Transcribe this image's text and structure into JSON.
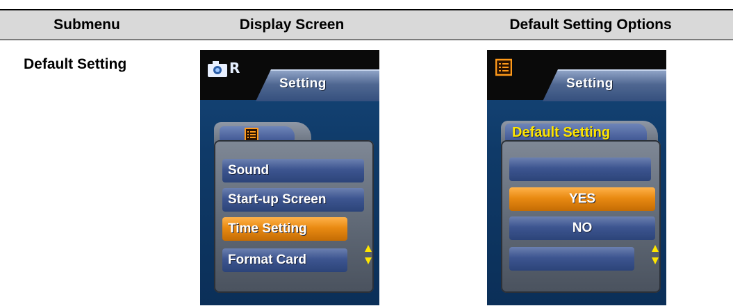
{
  "table": {
    "headers": [
      "Submenu",
      "Display Screen",
      "Default Setting Options"
    ],
    "row_label": "Default Setting"
  },
  "screen_left": {
    "mode_letter": "R",
    "tab_title": "Setting",
    "items": [
      "Sound",
      "Start-up Screen",
      "Time Setting",
      "Format Card"
    ],
    "selected_index": 2
  },
  "screen_right": {
    "tab_title": "Setting",
    "panel_title": "Default Setting",
    "items": [
      "",
      "YES",
      "NO",
      ""
    ],
    "selected_index": 1
  },
  "icons": {
    "camera": "camera-icon",
    "menu": "menu-list-icon",
    "scroll": "scroll-updown-icon"
  },
  "colors": {
    "header_bg": "#d9d9d9",
    "screen_blue": "#0f3a68",
    "menu_blue": "#3d5590",
    "selected_orange": "#e98a12",
    "title_yellow": "#ffe600"
  }
}
